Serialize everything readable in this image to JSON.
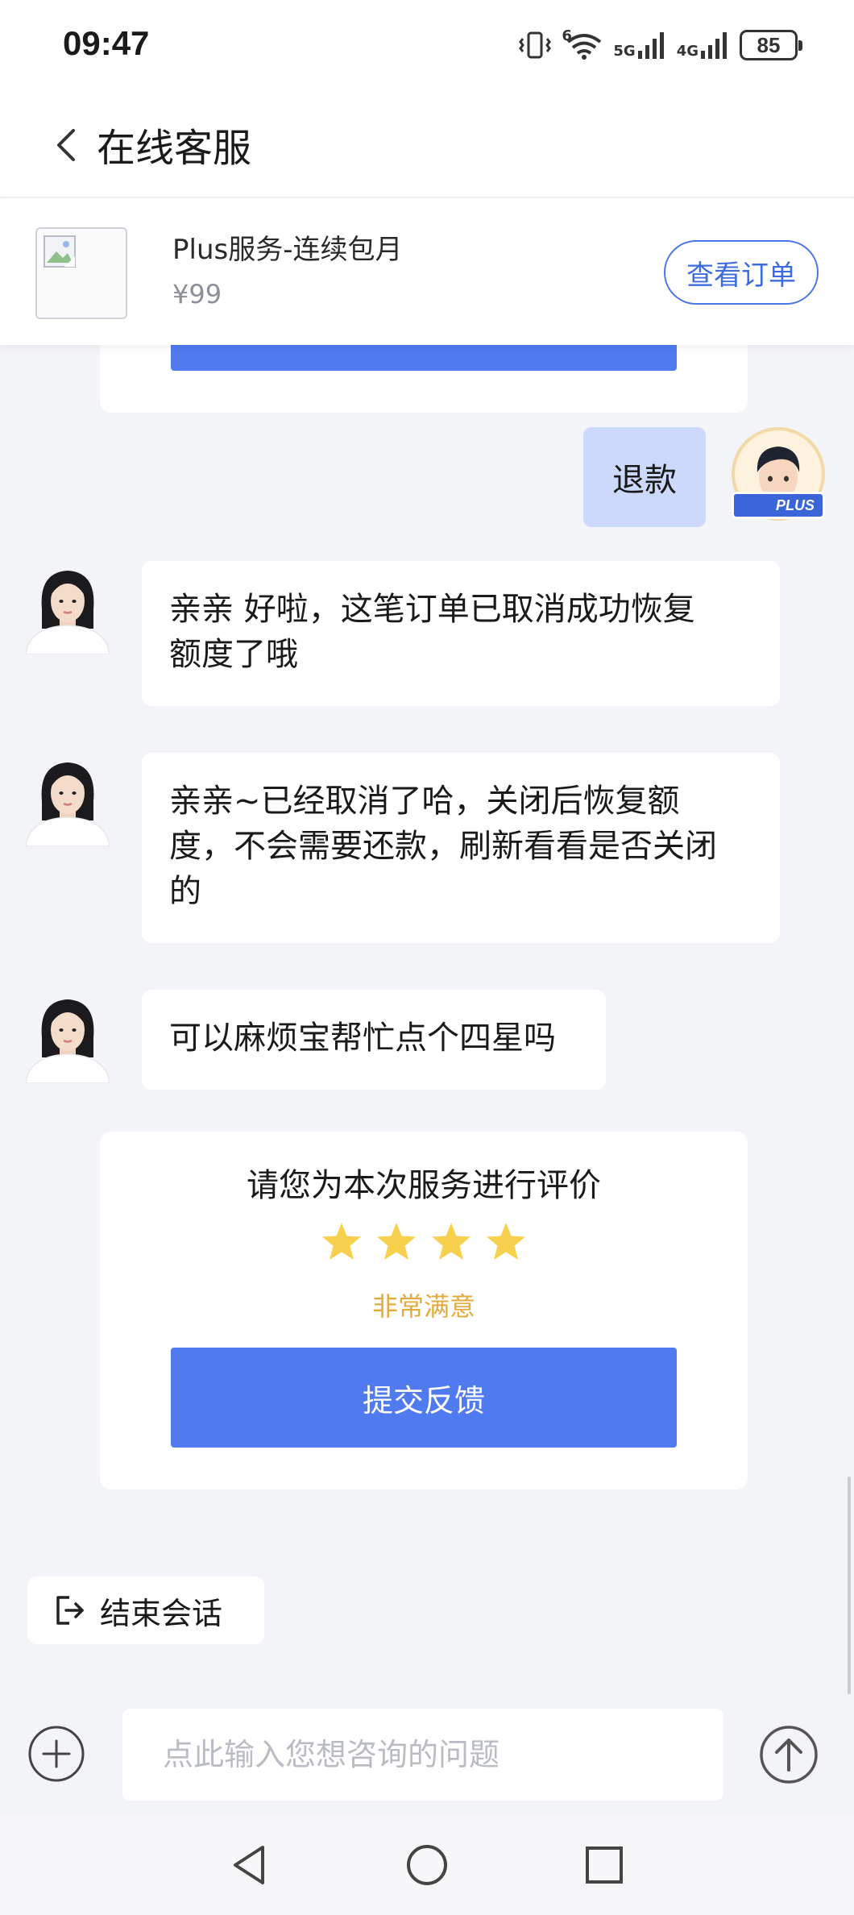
{
  "status_bar": {
    "time": "09:47",
    "net_5g": "5G",
    "net_4g": "4G",
    "wifi_tag": "6",
    "battery": "85"
  },
  "header": {
    "title": "在线客服",
    "back_icon": "chevron-left-icon"
  },
  "product": {
    "name": "Plus服务-连续包月",
    "price": "¥99",
    "view_order_label": "查看订单"
  },
  "messages": [
    {
      "from": "user",
      "text": "退款",
      "badge": "PLUS"
    },
    {
      "from": "agent",
      "lines": [
        "亲亲 好啦，这笔订单已取消成功恢复",
        "额度了哦"
      ]
    },
    {
      "from": "agent",
      "lines": [
        "亲亲~已经取消了哈，关闭后恢复额",
        "度，不会需要还款，刷新看看是否关闭",
        "的"
      ]
    },
    {
      "from": "agent",
      "lines": [
        "可以麻烦宝帮忙点个四星吗"
      ]
    }
  ],
  "rating": {
    "title": "请您为本次服务进行评价",
    "stars": 4,
    "max_stars": 4,
    "star_color": "#f7d14d",
    "result_text": "非常满意",
    "submit_label": "提交反馈"
  },
  "end_session_label": "结束会话",
  "input": {
    "placeholder": "点此输入您想咨询的问题"
  },
  "colors": {
    "accent": "#4f7af0",
    "user_bubble": "#cdd9fb",
    "background": "#f3f4f8"
  }
}
